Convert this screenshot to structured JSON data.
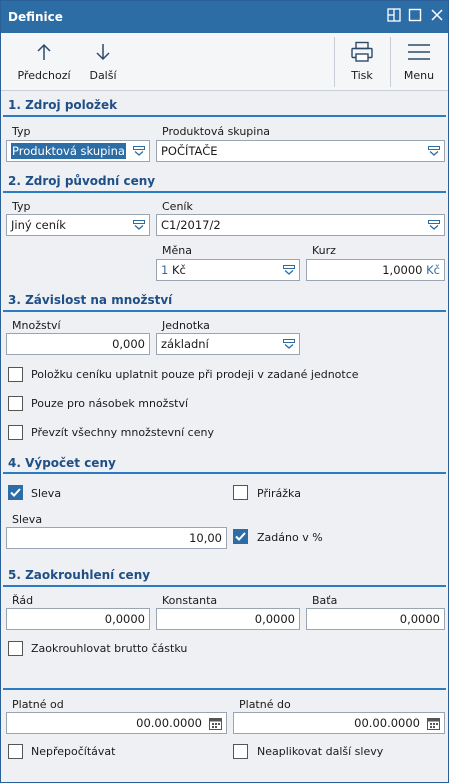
{
  "window": {
    "title": "Definice"
  },
  "toolbar": {
    "prev_label": "Předchozí",
    "next_label": "Další",
    "print_label": "Tisk",
    "menu_label": "Menu"
  },
  "s1": {
    "title": "1. Zdroj položek",
    "typ_label": "Typ",
    "typ_value": "Produktová skupina",
    "skupina_label": "Produktová skupina",
    "skupina_value": "POČÍTAČE"
  },
  "s2": {
    "title": "2. Zdroj původní ceny",
    "typ_label": "Typ",
    "typ_value": "Jiný ceník",
    "cenik_label": "Ceník",
    "cenik_value": "C1/2017/2",
    "mena_label": "Měna",
    "mena_prefix": "1",
    "mena_value": "Kč",
    "kurz_label": "Kurz",
    "kurz_value": "1,0000",
    "kurz_unit": "Kč"
  },
  "s3": {
    "title": "3. Závislost na množství",
    "mnozstvi_label": "Množství",
    "mnozstvi_value": "0,000",
    "jednotka_label": "Jednotka",
    "jednotka_value": "základní",
    "chk1_label": "Položku ceníku uplatnit pouze při prodeji v zadané jednotce",
    "chk2_label": "Pouze pro násobek množství",
    "chk3_label": "Převzít všechny množstevní ceny"
  },
  "s4": {
    "title": "4. Výpočet ceny",
    "sleva_chk_label": "Sleva",
    "prirazka_label": "Přirážka",
    "sleva_label": "Sleva",
    "sleva_value": "10,00",
    "zadano_label": "Zadáno v %"
  },
  "s5": {
    "title": "5. Zaokrouhlení ceny",
    "rad_label": "Řád",
    "rad_value": "0,0000",
    "konstanta_label": "Konstanta",
    "konstanta_value": "0,0000",
    "bata_label": "Baťa",
    "bata_value": "0,0000",
    "brutto_label": "Zaokrouhlovat brutto částku"
  },
  "validity": {
    "od_label": "Platné od",
    "od_value": "00.00.0000",
    "do_label": "Platné do",
    "do_value": "00.00.0000",
    "neprepocitavat_label": "Nepřepočítávat",
    "neaplikovat_label": "Neaplikovat další slevy"
  },
  "colors": {
    "accent": "#2d6da6",
    "section_line": "#2b7cc5"
  }
}
